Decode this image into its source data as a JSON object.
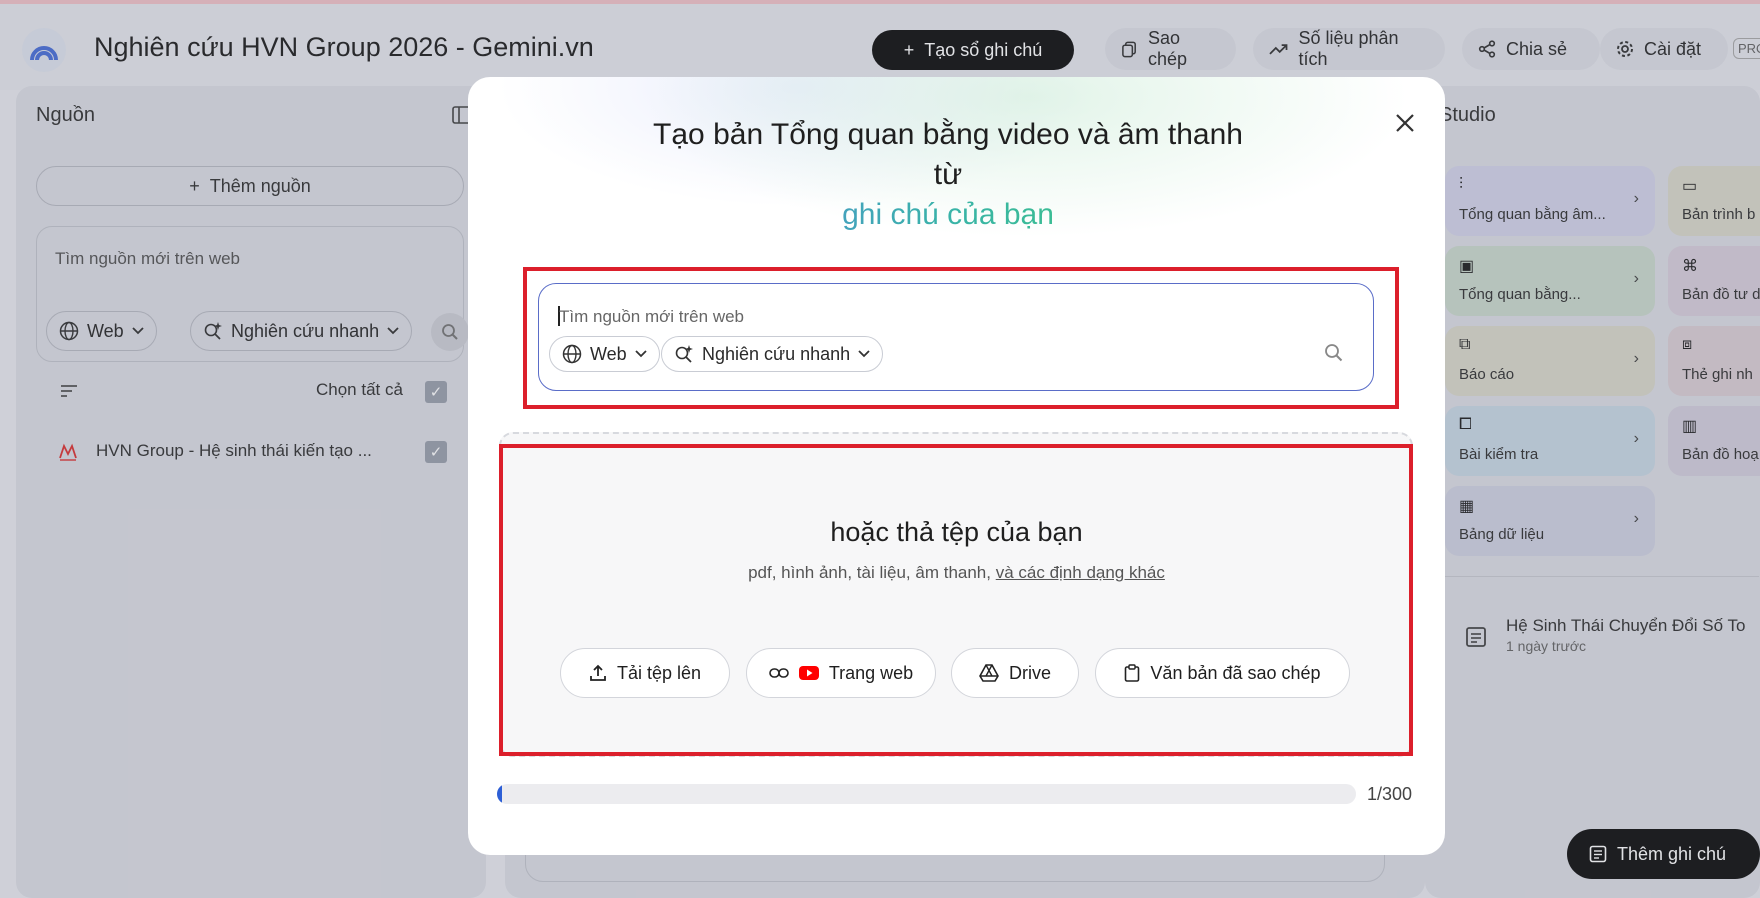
{
  "app": {
    "title": "Nghiên cứu HVN Group 2026 - Gemini.vn",
    "create_notebook": "Tạo sổ ghi chú",
    "copy": "Sao chép",
    "analytics": "Số liệu phân tích",
    "share": "Chia sẻ",
    "settings": "Cài đặt",
    "pro_badge": "PRO"
  },
  "sources": {
    "title": "Nguồn",
    "add_source": "Thêm nguồn",
    "search_placeholder": "Tìm nguồn mới trên web",
    "web_chip": "Web",
    "research_chip": "Nghiên cứu nhanh",
    "select_all": "Chọn tất cả",
    "items": [
      {
        "label": "HVN Group - Hệ sinh thái kiến tạo ..."
      }
    ]
  },
  "studio": {
    "title": "Studio",
    "cards": [
      {
        "label": "Tổng quan bằng âm...",
        "color": "#d3d4ea"
      },
      {
        "label": "Bản trình b",
        "color": "#d9d8cb"
      },
      {
        "label": "Tổng quan bằng...",
        "color": "#cbd9cd"
      },
      {
        "label": "Bản đồ tư d",
        "color": "#d8cfdc"
      },
      {
        "label": "Báo cáo",
        "color": "#dad8cb"
      },
      {
        "label": "Thẻ ghi nh",
        "color": "#dbcfd5"
      },
      {
        "label": "Bài kiểm tra",
        "color": "#c9d8e4"
      },
      {
        "label": "Bản đồ hoạ",
        "color": "#d4cfdd"
      },
      {
        "label": "Bảng dữ liệu",
        "color": "#d0d2e2"
      }
    ],
    "note_title": "Hệ Sinh Thái Chuyển Đổi Số To",
    "note_time": "1 ngày trước",
    "add_note": "Thêm ghi chú"
  },
  "modal": {
    "title_line1": "Tạo bản Tổng quan bằng video và âm thanh",
    "title_line2": "từ",
    "title_line3": "ghi chú của bạn",
    "search_placeholder": "Tìm nguồn mới trên web",
    "web_chip": "Web",
    "research_chip": "Nghiên cứu nhanh",
    "drop_title": "hoặc thả tệp của bạn",
    "drop_sub": "pdf, hình ảnh, tài liệu, âm thanh,",
    "drop_sub_link": "và các định dạng khác",
    "upload": "Tải tệp lên",
    "website": "Trang web",
    "drive": "Drive",
    "pasted_text": "Văn bản đã sao chép",
    "progress_value": 1,
    "progress_max": 300,
    "progress_label": "1/300"
  },
  "colors": {
    "accent_red": "#dc1f2b",
    "progress_blue": "#2d5fd6",
    "youtube_red": "#ff0000"
  }
}
